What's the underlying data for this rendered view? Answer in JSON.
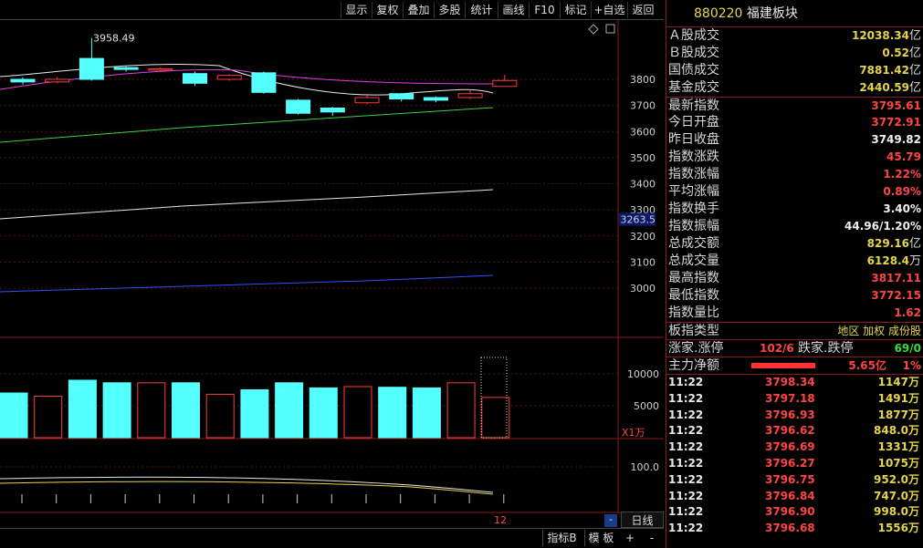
{
  "toolbar": {
    "buttons": [
      "显示",
      "复权",
      "叠加",
      "多股",
      "统计",
      "画线",
      "F10",
      "标记",
      "+自选",
      "返回"
    ]
  },
  "chart": {
    "high_annotation": "3958.49",
    "price_axis": [
      "3800",
      "3700",
      "3600",
      "3500",
      "3400",
      "3300",
      "3200",
      "3100",
      "3000"
    ],
    "current_price_tag": "3263.5",
    "volume_axis": [
      "10000",
      "5000"
    ],
    "volume_unit": "X1万",
    "indicator_axis": "100.0",
    "date_label": "12",
    "candles": [
      {
        "o": 3800,
        "c": 3790,
        "h": 3808,
        "l": 3780
      },
      {
        "o": 3790,
        "c": 3800,
        "h": 3810,
        "l": 3785
      },
      {
        "o": 3880,
        "c": 3800,
        "h": 3958.49,
        "l": 3795
      },
      {
        "o": 3845,
        "c": 3838,
        "h": 3850,
        "l": 3830
      },
      {
        "o": 3835,
        "c": 3840,
        "h": 3846,
        "l": 3828
      },
      {
        "o": 3822,
        "c": 3785,
        "h": 3830,
        "l": 3775
      },
      {
        "o": 3800,
        "c": 3815,
        "h": 3820,
        "l": 3795
      },
      {
        "o": 3825,
        "c": 3750,
        "h": 3830,
        "l": 3745
      },
      {
        "o": 3720,
        "c": 3670,
        "h": 3725,
        "l": 3665
      },
      {
        "o": 3690,
        "c": 3675,
        "h": 3695,
        "l": 3660
      },
      {
        "o": 3710,
        "c": 3730,
        "h": 3740,
        "l": 3705
      },
      {
        "o": 3745,
        "c": 3725,
        "h": 3748,
        "l": 3715
      },
      {
        "o": 3730,
        "c": 3720,
        "h": 3735,
        "l": 3712
      },
      {
        "o": 3730,
        "c": 3745,
        "h": 3760,
        "l": 3725
      },
      {
        "o": 3772.91,
        "c": 3795.61,
        "h": 3817.11,
        "l": 3772.15
      }
    ],
    "volumes": [
      7.0,
      6.5,
      9.0,
      8.6,
      8.6,
      8.6,
      6.8,
      7.5,
      8.6,
      7.8,
      8.0,
      7.9,
      7.8,
      8.6,
      6.3
    ]
  },
  "bottom": {
    "tab_index": "指标B",
    "tab_template": "模 板",
    "plus": "+",
    "minus": "-",
    "period": "日线"
  },
  "panel": {
    "code": "880220",
    "name": "福建板块",
    "stats": [
      {
        "label": "Ａ股成交",
        "value": "12038.34",
        "unit": "亿",
        "color": "yellow"
      },
      {
        "label": "Ｂ股成交",
        "value": "0.52",
        "unit": "亿",
        "color": "yellow"
      },
      {
        "label": "国债成交",
        "value": "7881.42",
        "unit": "亿",
        "color": "yellow"
      },
      {
        "label": "基金成交",
        "value": "2440.59",
        "unit": "亿",
        "color": "yellow"
      },
      {
        "label": "最新指数",
        "value": "3795.61",
        "unit": "",
        "color": "red"
      },
      {
        "label": "今日开盘",
        "value": "3772.91",
        "unit": "",
        "color": "red"
      },
      {
        "label": "昨日收盘",
        "value": "3749.82",
        "unit": "",
        "color": "white"
      },
      {
        "label": "指数涨跌",
        "value": "45.79",
        "unit": "",
        "color": "red"
      },
      {
        "label": "指数涨幅",
        "value": "1.22%",
        "unit": "",
        "color": "red"
      },
      {
        "label": "平均涨幅",
        "value": "0.89%",
        "unit": "",
        "color": "red"
      },
      {
        "label": "指数换手",
        "value": "3.40%",
        "unit": "",
        "color": "white"
      },
      {
        "label": "指数振幅",
        "value": "44.96/1.20%",
        "unit": "",
        "color": "white"
      },
      {
        "label": "总成交额",
        "value": "829.16",
        "unit": "亿",
        "color": "yellow"
      },
      {
        "label": "总成交量",
        "value": "6128.4",
        "unit": "万",
        "color": "yellow"
      },
      {
        "label": "最高指数",
        "value": "3817.11",
        "unit": "",
        "color": "red"
      },
      {
        "label": "最低指数",
        "value": "3772.15",
        "unit": "",
        "color": "red"
      },
      {
        "label": "指数量比",
        "value": "1.62",
        "unit": "",
        "color": "red"
      }
    ],
    "type_label": "板指类型",
    "type_value": "地区 加权 成份股",
    "updown": {
      "up_label": "涨家.涨停",
      "up_value": "102/6",
      "down_label": "跌家.跌停",
      "down_value": "69/0"
    },
    "main_flow": {
      "label": "主力净额",
      "value": "5.65亿",
      "pct": "1%",
      "bar_fraction": 0.7
    },
    "ticks": [
      {
        "time": "11:22",
        "price": "3798.34",
        "vol": "1147万"
      },
      {
        "time": "11:22",
        "price": "3797.18",
        "vol": "1491万"
      },
      {
        "time": "11:22",
        "price": "3796.93",
        "vol": "1877万"
      },
      {
        "time": "11:22",
        "price": "3796.62",
        "vol": "848.0万"
      },
      {
        "time": "11:22",
        "price": "3796.69",
        "vol": "1331万"
      },
      {
        "time": "11:22",
        "price": "3796.27",
        "vol": "1075万"
      },
      {
        "time": "11:22",
        "price": "3796.75",
        "vol": "952.0万"
      },
      {
        "time": "11:22",
        "price": "3796.84",
        "vol": "747.0万"
      },
      {
        "time": "11:22",
        "price": "3796.90",
        "vol": "998.0万"
      },
      {
        "time": "11:22",
        "price": "3796.68",
        "vol": "1556万"
      }
    ]
  }
}
